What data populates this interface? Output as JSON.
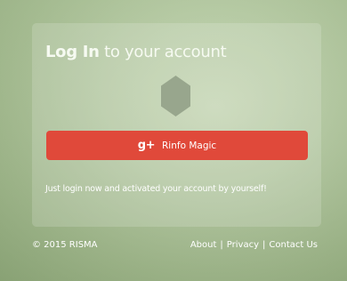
{
  "login": {
    "title_bold": "Log In",
    "title_rest": "to your account",
    "google_icon": "gplus-icon",
    "google_icon_text": "g+",
    "button_label": "Rinfo Magic",
    "note": "Just login now and activated your account by yourself!"
  },
  "footer": {
    "copyright": "© 2015 RISMA",
    "links": [
      "About",
      "Privacy",
      "Contact Us"
    ],
    "separator": "|"
  },
  "colors": {
    "button": "#e0493a",
    "hexagon": "#98a68d",
    "background": "#b4c9a1"
  }
}
